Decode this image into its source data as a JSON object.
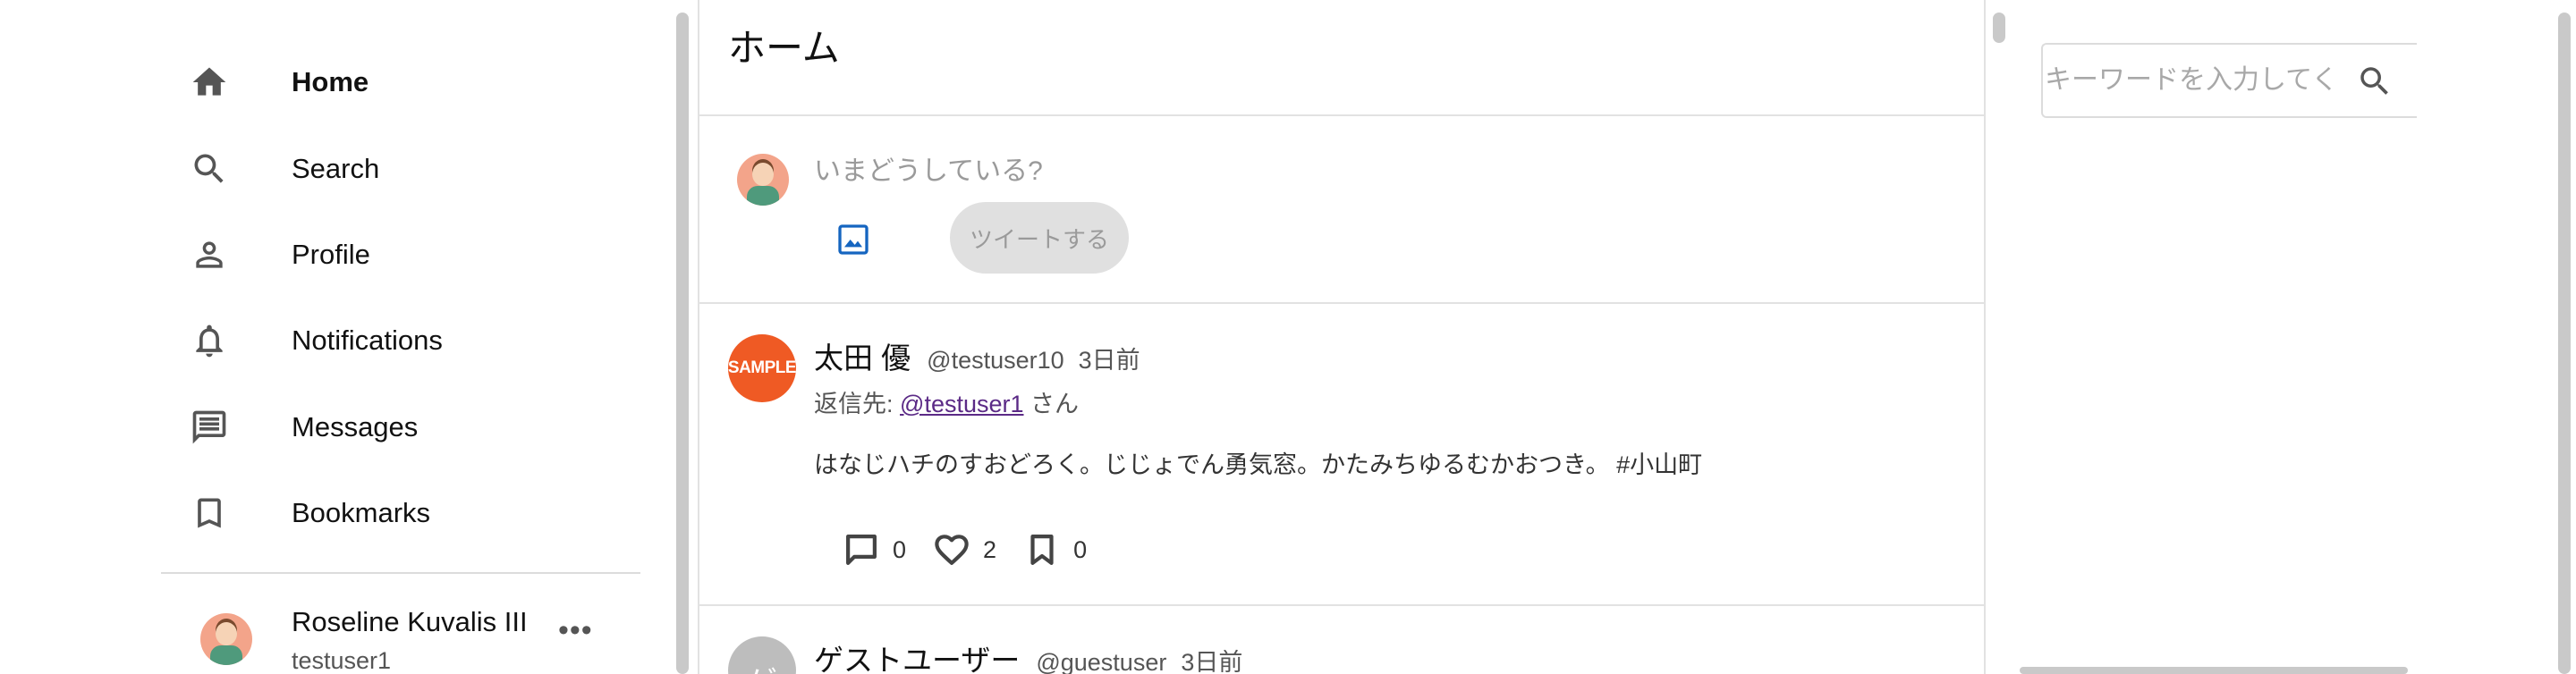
{
  "sidebar": {
    "items": [
      {
        "label": "Home",
        "icon": "home-icon",
        "active": true
      },
      {
        "label": "Search",
        "icon": "search-icon"
      },
      {
        "label": "Profile",
        "icon": "person-icon"
      },
      {
        "label": "Notifications",
        "icon": "bell-icon"
      },
      {
        "label": "Messages",
        "icon": "message-icon"
      },
      {
        "label": "Bookmarks",
        "icon": "bookmark-icon"
      }
    ],
    "account": {
      "name": "Roseline Kuvalis III",
      "handle": "testuser1",
      "more": "•••"
    }
  },
  "main": {
    "title": "ホーム",
    "compose": {
      "placeholder": "いまどうしている?",
      "tweet_button": "ツイートする"
    },
    "tweets": [
      {
        "name": "太田 優",
        "handle": "@testuser10",
        "time": "3日前",
        "avatar_text": "SAMPLE",
        "reply_prefix": "返信先:",
        "reply_to": "@testuser1",
        "reply_suffix": "さん",
        "body": "はなじハチのすおどろく。じじょでん勇気窓。かたみちゆるむかおつき。 #小山町",
        "replies": "0",
        "likes": "2",
        "bookmarks": "0"
      },
      {
        "name": "ゲストユーザー",
        "handle": "@guestuser",
        "time": "3日前",
        "avatar_text": "ゲ"
      }
    ]
  },
  "right": {
    "search_placeholder": "キーワードを入力してください"
  },
  "colors": {
    "accent_blue": "#1565c0",
    "sample_avatar": "#ef5a24",
    "link": "#5b2a86"
  }
}
